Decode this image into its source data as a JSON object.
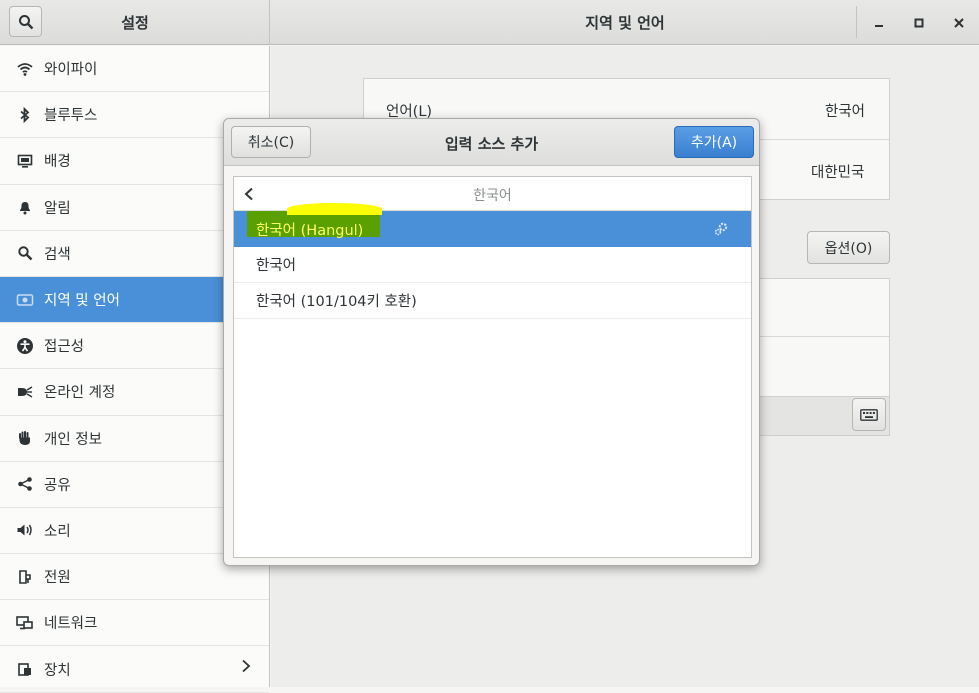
{
  "window": {
    "sidebar_title": "설정",
    "main_title": "지역 및 언어",
    "minimize": "_",
    "maximize": "□",
    "close": "✕"
  },
  "sidebar": {
    "items": [
      {
        "label": "와이파이",
        "icon": "wifi-icon"
      },
      {
        "label": "블루투스",
        "icon": "bluetooth-icon"
      },
      {
        "label": "배경",
        "icon": "background-icon"
      },
      {
        "label": "알림",
        "icon": "bell-icon"
      },
      {
        "label": "검색",
        "icon": "search-icon"
      },
      {
        "label": "지역 및 언어",
        "icon": "region-icon",
        "selected": true
      },
      {
        "label": "접근성",
        "icon": "accessibility-icon"
      },
      {
        "label": "온라인 계정",
        "icon": "online-accounts-icon"
      },
      {
        "label": "개인 정보",
        "icon": "privacy-hand-icon"
      },
      {
        "label": "공유",
        "icon": "share-icon"
      },
      {
        "label": "소리",
        "icon": "speaker-icon"
      },
      {
        "label": "전원",
        "icon": "power-icon"
      },
      {
        "label": "네트워크",
        "icon": "network-icon"
      },
      {
        "label": "장치",
        "icon": "devices-icon"
      }
    ]
  },
  "main": {
    "language_label": "언어(L)",
    "language_value": "한국어",
    "formats_value": "대한민국",
    "options_button": "옵션(O)"
  },
  "dialog": {
    "title": "입력 소스 추가",
    "cancel": "취소(C)",
    "add": "추가(A)",
    "list_header": "한국어",
    "items": [
      {
        "label": "한국어 (Hangul)",
        "selected": true
      },
      {
        "label": "한국어"
      },
      {
        "label": "한국어 (101/104키 호환)"
      }
    ]
  },
  "colors": {
    "accent": "#4a90d9",
    "highlight_green": "#5aa000",
    "highlight_yellow": "#ffff00"
  }
}
